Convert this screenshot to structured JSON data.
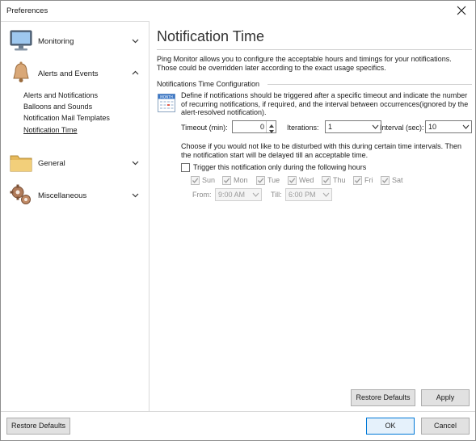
{
  "window": {
    "title": "Preferences"
  },
  "sidebar": {
    "categories": [
      {
        "label": "Monitoring",
        "icon": "monitor-icon",
        "expanded": false
      },
      {
        "label": "Alerts and Events",
        "icon": "bell-icon",
        "expanded": true,
        "items": [
          "Alerts and Notifications",
          "Balloons and Sounds",
          "Notification Mail Templates",
          "Notification Time"
        ]
      },
      {
        "label": "General",
        "icon": "folder-icon",
        "expanded": false
      },
      {
        "label": "Miscellaneous",
        "icon": "gears-icon",
        "expanded": false
      }
    ],
    "active_item": "Notification Time"
  },
  "main": {
    "title": "Notification Time",
    "description": "Ping Monitor allows you to configure the acceptable hours and timings for your notifications. Those could be overridden later according to the exact usage specifics.",
    "section_label": "Notifications Time Configuration",
    "calendar_icon_text": "MONTH",
    "paragraph1": "Define if notifications should be triggered after a specific timeout and indicate the number of recurring notifications, if required, and the interval between occurrences(ignored by the alert-resolved notification).",
    "timeout": {
      "label": "Timeout (min):",
      "value": "0"
    },
    "iterations": {
      "label": "Iterations:",
      "value": "1"
    },
    "interval": {
      "label": "Interval (sec):",
      "value": "10"
    },
    "paragraph2": "Choose if you would not like to be disturbed with this during certain time intervals. Then the notification start will be delayed till an acceptable time.",
    "trigger": {
      "label": "Trigger this notification only during the following hours",
      "checked": false
    },
    "days": [
      {
        "label": "Sun",
        "checked": true
      },
      {
        "label": "Mon",
        "checked": true
      },
      {
        "label": "Tue",
        "checked": true
      },
      {
        "label": "Wed",
        "checked": true
      },
      {
        "label": "Thu",
        "checked": true
      },
      {
        "label": "Fri",
        "checked": true
      },
      {
        "label": "Sat",
        "checked": true
      }
    ],
    "from": {
      "label": "From:",
      "value": "9:00 AM"
    },
    "till": {
      "label": "Till:",
      "value": "6:00 PM"
    },
    "restore_defaults": "Restore Defaults",
    "apply": "Apply"
  },
  "footer": {
    "restore_defaults": "Restore Defaults",
    "ok": "OK",
    "cancel": "Cancel"
  },
  "colors": {
    "accent": "#0078d7",
    "button_face": "#e1e1e1",
    "disabled_text": "#8a8a8a"
  }
}
